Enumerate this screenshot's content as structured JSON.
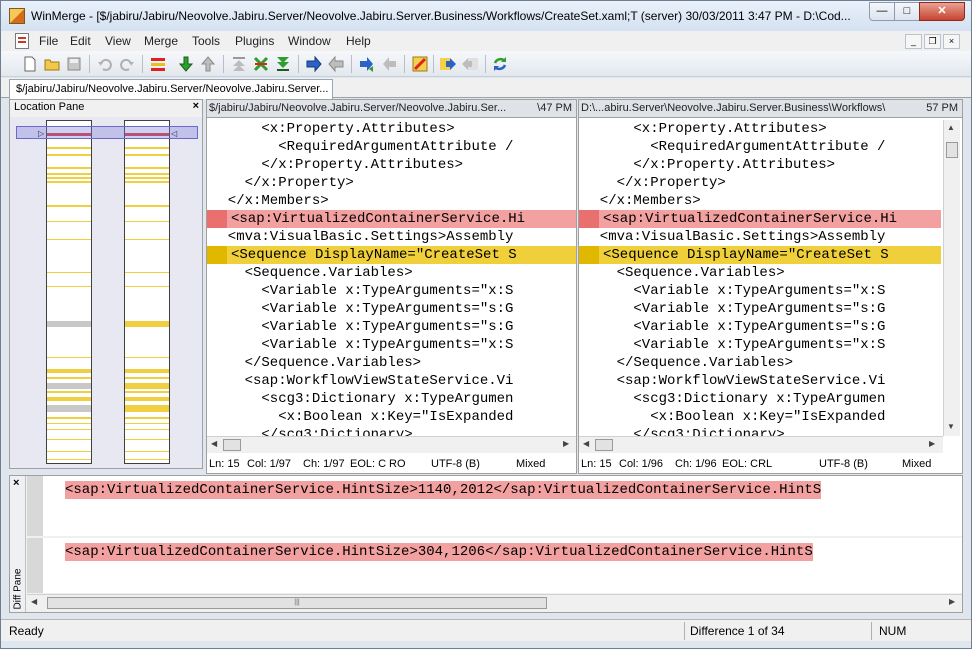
{
  "window": {
    "title": "WinMerge - [$/jabiru/Jabiru/Neovolve.Jabiru.Server/Neovolve.Jabiru.Server.Business/Workflows/CreateSet.xaml;T  (server)    30/03/2011 3:47 PM - D:\\Cod...",
    "min_glyph": "—",
    "max_glyph": "□",
    "close_glyph": "✕"
  },
  "menu": {
    "items": [
      "File",
      "Edit",
      "View",
      "Merge",
      "Tools",
      "Plugins",
      "Window",
      "Help"
    ],
    "mdi_min": "_",
    "mdi_restore": "❐",
    "mdi_close": "×"
  },
  "toolbar": {
    "icons": [
      "new-icon",
      "open-icon",
      "save-icon",
      "undo-icon",
      "redo-icon",
      "diff-options-icon",
      "next-diff-icon",
      "prev-diff-icon",
      "first-diff-icon",
      "current-diff-icon",
      "last-diff-icon",
      "copy-right-icon",
      "copy-left-icon",
      "copy-right-advance-icon",
      "copy-left-advance-icon",
      "all-right-icon",
      "all-left-icon",
      "refresh-icon"
    ]
  },
  "tab": {
    "label": "$/jabiru/Jabiru/Neovolve.Jabiru.Server/Neovolve.Jabiru.Server..."
  },
  "location_pane": {
    "title": "Location Pane",
    "close": "×"
  },
  "left_editor": {
    "header_path": "$/jabiru/Jabiru/Neovolve.Jabiru.Server/Neovolve.Jabiru.Ser...",
    "header_time": "\\47 PM",
    "lines": [
      {
        "text": "      <x:Property.Attributes>",
        "kind": "normal"
      },
      {
        "text": "        <RequiredArgumentAttribute /",
        "kind": "normal"
      },
      {
        "text": "      </x:Property.Attributes>",
        "kind": "normal"
      },
      {
        "text": "    </x:Property>",
        "kind": "normal"
      },
      {
        "text": "  </x:Members>",
        "kind": "normal"
      },
      {
        "text": "<sap:VirtualizedContainerService.Hi",
        "kind": "red"
      },
      {
        "text": "  <mva:VisualBasic.Settings>Assembly",
        "kind": "normal"
      },
      {
        "text": "<Sequence DisplayName=\"CreateSet S",
        "kind": "yellow"
      },
      {
        "text": "    <Sequence.Variables>",
        "kind": "normal"
      },
      {
        "text": "      <Variable x:TypeArguments=\"x:S",
        "kind": "normal"
      },
      {
        "text": "      <Variable x:TypeArguments=\"s:G",
        "kind": "normal"
      },
      {
        "text": "      <Variable x:TypeArguments=\"s:G",
        "kind": "normal"
      },
      {
        "text": "      <Variable x:TypeArguments=\"x:S",
        "kind": "normal"
      },
      {
        "text": "    </Sequence.Variables>",
        "kind": "normal"
      },
      {
        "text": "    <sap:WorkflowViewStateService.Vi",
        "kind": "normal"
      },
      {
        "text": "      <scg3:Dictionary x:TypeArgumen",
        "kind": "normal"
      },
      {
        "text": "        <x:Boolean x:Key=\"IsExpanded",
        "kind": "normal"
      },
      {
        "text": "      </scg3:Dictionary>",
        "kind": "normal"
      }
    ],
    "status": {
      "ln": "Ln: 15",
      "col": "Col: 1/97",
      "ch": "Ch: 1/97",
      "eol": "EOL: C",
      "ro": "RO",
      "enc": "UTF-8 (B)",
      "mode": "Mixed"
    }
  },
  "right_editor": {
    "header_path": "D:\\...abiru.Server\\Neovolve.Jabiru.Server.Business\\Workflows\\",
    "header_time": "57 PM",
    "lines": [
      {
        "text": "      <x:Property.Attributes>",
        "kind": "normal"
      },
      {
        "text": "        <RequiredArgumentAttribute /",
        "kind": "normal"
      },
      {
        "text": "      </x:Property.Attributes>",
        "kind": "normal"
      },
      {
        "text": "    </x:Property>",
        "kind": "normal"
      },
      {
        "text": "  </x:Members>",
        "kind": "normal"
      },
      {
        "text": "<sap:VirtualizedContainerService.Hi",
        "kind": "red"
      },
      {
        "text": "  <mva:VisualBasic.Settings>Assembly",
        "kind": "normal"
      },
      {
        "text": "<Sequence DisplayName=\"CreateSet S",
        "kind": "yellow"
      },
      {
        "text": "    <Sequence.Variables>",
        "kind": "normal"
      },
      {
        "text": "      <Variable x:TypeArguments=\"x:S",
        "kind": "normal"
      },
      {
        "text": "      <Variable x:TypeArguments=\"s:G",
        "kind": "normal"
      },
      {
        "text": "      <Variable x:TypeArguments=\"s:G",
        "kind": "normal"
      },
      {
        "text": "      <Variable x:TypeArguments=\"x:S",
        "kind": "normal"
      },
      {
        "text": "    </Sequence.Variables>",
        "kind": "normal"
      },
      {
        "text": "    <sap:WorkflowViewStateService.Vi",
        "kind": "normal"
      },
      {
        "text": "      <scg3:Dictionary x:TypeArgumen",
        "kind": "normal"
      },
      {
        "text": "        <x:Boolean x:Key=\"IsExpanded",
        "kind": "normal"
      },
      {
        "text": "      </scg3:Dictionary>",
        "kind": "normal"
      }
    ],
    "status": {
      "ln": "Ln: 15",
      "col": "Col: 1/96",
      "ch": "Ch: 1/96",
      "eol": "EOL: CRL",
      "enc": "UTF-8 (B)",
      "mode": "Mixed"
    }
  },
  "diff_pane": {
    "title": "Diff Pane",
    "close": "×",
    "top_text": "<sap:VirtualizedContainerService.HintSize>1140,2012</sap:VirtualizedContainerService.HintS",
    "bottom_text": "<sap:VirtualizedContainerService.HintSize>304,1206</sap:VirtualizedContainerService.HintS"
  },
  "statusbar": {
    "state": "Ready",
    "difference": "Difference 1 of 34",
    "num": "NUM"
  },
  "colors": {
    "diff_red": "#f3a0a0",
    "diff_yellow": "#efcf3a",
    "location_gray": "#c8c8c8"
  }
}
